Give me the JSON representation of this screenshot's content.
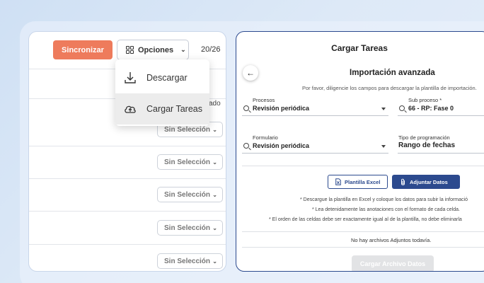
{
  "toolbar": {
    "sync_label": "Sincronizar",
    "options_label": "Opciones",
    "counter": "20/26"
  },
  "menu": {
    "items": [
      {
        "label": "Descargar",
        "icon": "download-icon"
      },
      {
        "label": "Cargar Tareas",
        "icon": "cloud-upload-icon"
      }
    ]
  },
  "list": {
    "header_fragment": "ado",
    "select_label": "Sin Selección",
    "rows": [
      "Sin Selección",
      "Sin Selección",
      "Sin Selección",
      "Sin Selección",
      "Sin Selección"
    ]
  },
  "modal": {
    "title": "Cargar Tareas",
    "subtitle": "Importación avanzada",
    "hint": "Por favor, diligencie los campos para descargar la plantilla de importación.",
    "fields": {
      "procesos": {
        "label": "Procesos",
        "value": "Revisión periódica"
      },
      "subproceso": {
        "label": "Sub proceso *",
        "value": "66 - RP: Fase 0"
      },
      "formulario": {
        "label": "Formulario",
        "value": "Revisión periódica"
      },
      "tipo": {
        "label": "Tipo de programación",
        "value": "Rango de fechas"
      }
    },
    "excel_label": "Plantilla Excel",
    "attach_label": "Adjuntar Datos",
    "notes": [
      "* Descargue la plantilla en Excel y coloque los datos para subir la informació",
      "* Lea detenidamente las anotaciones con el formato de cada celda.",
      "* El orden de las celdas debe ser exactamente igual al de la plantilla, no debe eliminarla"
    ],
    "no_files": "No hay archivos Adjuntos todavía.",
    "upload_label": "Cargar Archivo Datos"
  },
  "colors": {
    "accent": "#ee7b5c",
    "primary": "#2c4a8e",
    "disabled": "#e2e3e5"
  }
}
